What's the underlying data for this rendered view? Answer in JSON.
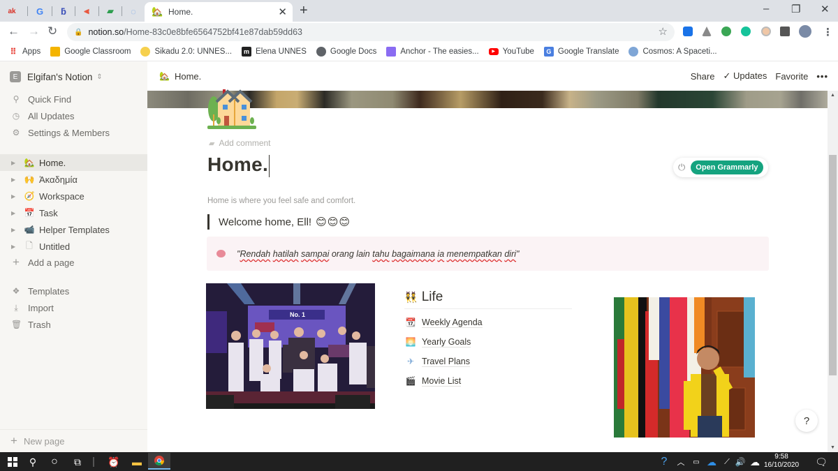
{
  "browser": {
    "pinned_tabs": [
      {
        "icon": "ak-icon",
        "glyph": "ak",
        "color": "#d93025"
      },
      {
        "icon": "google-icon",
        "glyph": "G",
        "color": "#4285f4"
      },
      {
        "icon": "b-app-icon",
        "glyph": "ƃ",
        "color": "#3b4fb8"
      },
      {
        "icon": "red-app-icon",
        "glyph": "⫷",
        "color": "#e8553d"
      },
      {
        "icon": "green-book-icon",
        "glyph": "▰",
        "color": "#2e9e4f"
      },
      {
        "icon": "blue-circle-icon",
        "glyph": "◌",
        "color": "#7aa7e8"
      }
    ],
    "active_tab": {
      "title": "Home.",
      "icon": "house-icon",
      "close": "✕"
    },
    "new_tab": "+",
    "window_controls": {
      "minimize": "–",
      "restore": "❐",
      "close": "✕"
    },
    "url": {
      "host": "notion.so",
      "path": "/Home-83c0e8bfe6564752bf41e87dab59dd63"
    },
    "bookmarks": [
      {
        "label": "Apps",
        "icon": "apps-grid-icon",
        "color": "#e8453c"
      },
      {
        "label": "Google Classroom",
        "icon": "classroom-icon",
        "color": "#f4b400"
      },
      {
        "label": "Sikadu 2.0: UNNES...",
        "icon": "sikadu-icon",
        "color": "#f6d04d"
      },
      {
        "label": "Elena UNNES",
        "icon": "elena-icon",
        "color": "#222222"
      },
      {
        "label": "Google Docs",
        "icon": "globe-icon",
        "color": "#5f6368"
      },
      {
        "label": "Anchor - The easies...",
        "icon": "anchor-icon",
        "color": "#8a6cf2"
      },
      {
        "label": "YouTube",
        "icon": "youtube-icon",
        "color": "#ff0000"
      },
      {
        "label": "Google Translate",
        "icon": "translate-icon",
        "color": "#4a7fe0"
      },
      {
        "label": "Cosmos: A Spaceti...",
        "icon": "cosmos-icon",
        "color": "#7fa6d6"
      }
    ]
  },
  "sidebar": {
    "workspace": {
      "initial": "E",
      "name": "Elgifan's Notion"
    },
    "utilities": [
      {
        "label": "Quick Find",
        "icon": "search-icon",
        "glyph": "⚲"
      },
      {
        "label": "All Updates",
        "icon": "clock-icon",
        "glyph": "◷"
      },
      {
        "label": "Settings & Members",
        "icon": "gear-icon",
        "glyph": "⚙"
      }
    ],
    "pages": [
      {
        "label": "Home.",
        "icon": "house-icon",
        "glyph": "🏡",
        "selected": true
      },
      {
        "label": "Ἀκαδημία",
        "icon": "yellow-hands-icon",
        "glyph": "🙌",
        "selected": false
      },
      {
        "label": "Workspace",
        "icon": "compass-icon",
        "glyph": "🧭",
        "selected": false
      },
      {
        "label": "Task",
        "icon": "calendar-icon",
        "glyph": "📅",
        "selected": false
      },
      {
        "label": "Helper Templates",
        "icon": "video-camera-icon",
        "glyph": "📹",
        "selected": false
      },
      {
        "label": "Untitled",
        "icon": "page-icon",
        "glyph": "🗋",
        "selected": false
      }
    ],
    "add_page": "Add a page",
    "tools": [
      {
        "label": "Templates",
        "icon": "templates-icon",
        "glyph": "❖"
      },
      {
        "label": "Import",
        "icon": "import-icon",
        "glyph": "⤓"
      },
      {
        "label": "Trash",
        "icon": "trash-icon",
        "glyph": "🗑"
      }
    ],
    "new_page": "New page"
  },
  "topbar": {
    "breadcrumb": "Home.",
    "share": "Share",
    "updates": "Updates",
    "favorite": "Favorite",
    "more": "•••"
  },
  "page": {
    "add_comment": "Add comment",
    "title": "Home.",
    "subtitle": "Home is where you feel safe and comfort.",
    "quote": "Welcome home, Ell!",
    "quote_emoji": "😊😊😊",
    "callout": {
      "open_quote": "\"",
      "words": [
        "Rendah",
        "hatilah",
        "sampai",
        "orang",
        "lain",
        "tahu",
        "bagaimana",
        "ia",
        "menempatkan",
        "diri"
      ],
      "misspelled": [
        true,
        true,
        true,
        false,
        false,
        true,
        true,
        true,
        true,
        true
      ],
      "close_quote": "\""
    },
    "life": {
      "heading": "Life",
      "heading_icon": "👯",
      "links": [
        {
          "label": "Weekly Agenda",
          "icon": "calendar-date-icon",
          "glyph": "📆"
        },
        {
          "label": "Yearly Goals",
          "icon": "sunrise-icon",
          "glyph": "🌅"
        },
        {
          "label": "Travel Plans",
          "icon": "airplane-icon",
          "glyph": "✈"
        },
        {
          "label": "Movie List",
          "icon": "clapper-icon",
          "glyph": "🎬"
        }
      ]
    },
    "grammarly": {
      "button": "Open Grammarly"
    },
    "help": "?"
  },
  "taskbar": {
    "time": "9:58",
    "date": "16/10/2020"
  }
}
